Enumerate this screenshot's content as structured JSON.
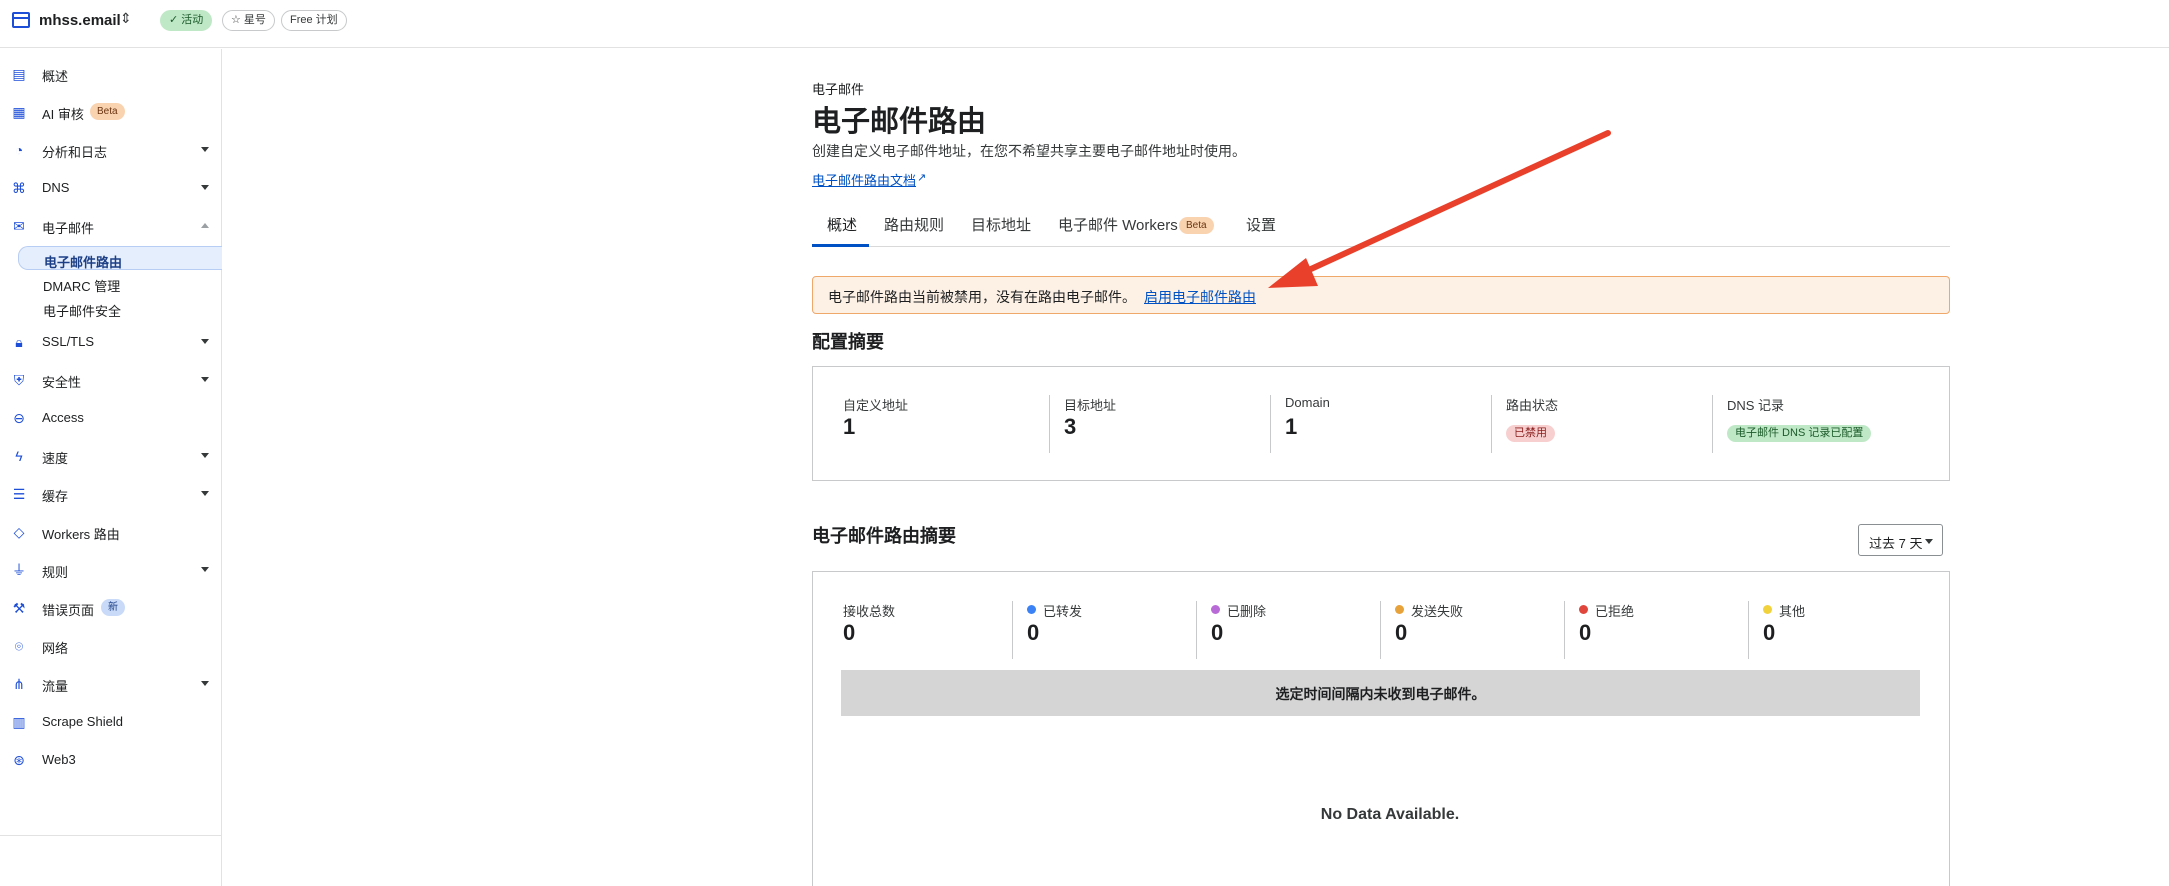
{
  "topbar": {
    "site_name": "mhss.email",
    "status_badge": "活动",
    "star_label": "星号",
    "plan_label": "Free 计划"
  },
  "sidebar": {
    "items": [
      {
        "label": "概述",
        "icon": "clipboard-icon"
      },
      {
        "label": "AI 审核",
        "icon": "ai-audit-icon",
        "badge": "Beta"
      },
      {
        "label": "分析和日志",
        "icon": "analytics-icon"
      },
      {
        "label": "DNS",
        "icon": "dns-icon"
      },
      {
        "label": "电子邮件",
        "icon": "email-icon"
      },
      {
        "label": "SSL/TLS",
        "icon": "lock-icon"
      },
      {
        "label": "安全性",
        "icon": "shield-icon"
      },
      {
        "label": "Access",
        "icon": "access-icon"
      },
      {
        "label": "速度",
        "icon": "lightning-icon"
      },
      {
        "label": "缓存",
        "icon": "cache-icon"
      },
      {
        "label": "Workers 路由",
        "icon": "workers-icon"
      },
      {
        "label": "规则",
        "icon": "rules-icon"
      },
      {
        "label": "错误页面",
        "icon": "wrench-icon",
        "badge": "新"
      },
      {
        "label": "网络",
        "icon": "location-pin-icon"
      },
      {
        "label": "流量",
        "icon": "traffic-icon"
      },
      {
        "label": "Scrape Shield",
        "icon": "scrape-shield-icon"
      },
      {
        "label": "Web3",
        "icon": "web3-icon"
      }
    ],
    "email_sub": [
      "电子邮件路由",
      "DMARC 管理",
      "电子邮件安全"
    ]
  },
  "main": {
    "eyebrow": "电子邮件",
    "title": "电子邮件路由",
    "description": "创建自定义电子邮件地址，在您不希望共享主要电子邮件地址时使用。",
    "doc_link": "电子邮件路由文档",
    "tabs": [
      "概述",
      "路由规则",
      "目标地址",
      "电子邮件 Workers",
      "设置"
    ],
    "workers_tab_badge": "Beta",
    "alert_text": "电子邮件路由当前被禁用，没有在路由电子邮件。",
    "alert_link": "启用电子邮件路由",
    "config_summary": {
      "title": "配置摘要",
      "stats": [
        {
          "label": "自定义地址",
          "value": "1"
        },
        {
          "label": "目标地址",
          "value": "3"
        },
        {
          "label": "Domain",
          "value": "1"
        },
        {
          "label": "路由状态",
          "tag": "已禁用"
        },
        {
          "label": "DNS 记录",
          "tag": "电子邮件 DNS 记录已配置"
        }
      ]
    },
    "routing_summary": {
      "title": "电子邮件路由摘要",
      "range": "过去 7 天",
      "stats": [
        {
          "label": "接收总数",
          "value": "0"
        },
        {
          "label": "已转发",
          "value": "0",
          "color": "#3b82f6"
        },
        {
          "label": "已删除",
          "value": "0",
          "color": "#b86ad6"
        },
        {
          "label": "发送失败",
          "value": "0",
          "color": "#e8a23a"
        },
        {
          "label": "已拒绝",
          "value": "0",
          "color": "#e0463c"
        },
        {
          "label": "其他",
          "value": "0",
          "color": "#f2d23c"
        }
      ],
      "empty_message": "选定时间间隔内未收到电子邮件。",
      "no_data": "No Data Available."
    }
  }
}
